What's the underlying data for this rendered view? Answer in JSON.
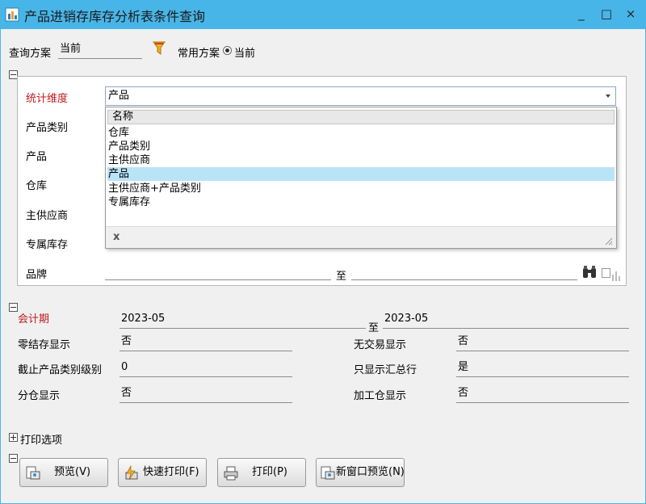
{
  "window": {
    "title": "产品进销存库存分析表条件查询",
    "minimize": "_",
    "maximize": "□",
    "close": "×"
  },
  "scheme": {
    "label": "查询方案",
    "value": "当前",
    "common_label": "常用方案",
    "radio_label": "当前"
  },
  "filters": {
    "dimension_label": "统计维度",
    "dimension_value": "产品",
    "rows": [
      {
        "label": "产品类别"
      },
      {
        "label": "产品"
      },
      {
        "label": "仓库"
      },
      {
        "label": "主供应商"
      },
      {
        "label": "专属库存"
      },
      {
        "label": "品牌"
      }
    ],
    "to_label": "至"
  },
  "dropdown": {
    "header": "名称",
    "items": [
      "仓库",
      "产品类别",
      "主供应商",
      "产品",
      "主供应商+产品类别",
      "专属库存"
    ],
    "selected_index": 3,
    "clear": "x"
  },
  "period": {
    "label": "会计期",
    "from": "2023-05",
    "to_label": "至",
    "to": "2023-05"
  },
  "options": {
    "zero_stock_label": "零结存显示",
    "zero_stock_value": "否",
    "no_trade_label": "无交易显示",
    "no_trade_value": "否",
    "category_level_label": "截止产品类别级别",
    "category_level_value": "0",
    "only_total_label": "只显示汇总行",
    "only_total_value": "是",
    "by_warehouse_label": "分仓显示",
    "by_warehouse_value": "否",
    "processing_label": "加工仓显示",
    "processing_value": "否"
  },
  "print": {
    "section_label": "打印选项"
  },
  "buttons": {
    "preview": "预览(V)",
    "quick_print": "快速打印(F)",
    "print": "打印(P)",
    "new_window_preview": "新窗口预览(N)"
  },
  "colors": {
    "titlebar": "#48b5e8",
    "required_label": "#c0191b",
    "selected_row": "#b9e4f7"
  }
}
